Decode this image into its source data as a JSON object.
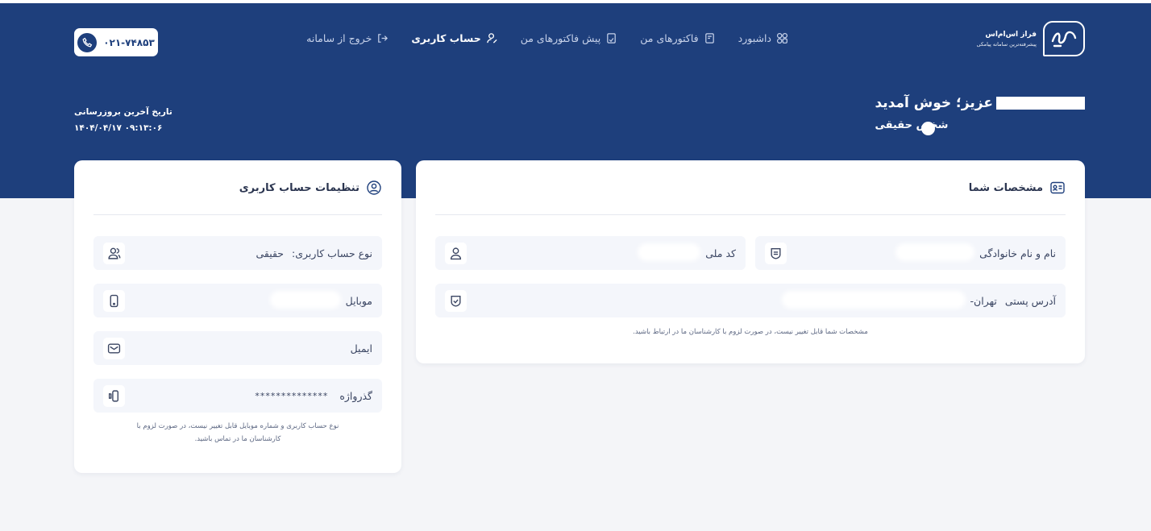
{
  "brand": {
    "name": "فراز اس‌ام‌اس",
    "tagline": "پیشرفته‌ترین سامانه پیامکی"
  },
  "nav": {
    "items": [
      {
        "label": "داشبورد",
        "icon": "dashboard-icon",
        "active": false
      },
      {
        "label": "فاکتورهای من",
        "icon": "invoice-icon",
        "active": false
      },
      {
        "label": "پیش فاکتورهای من",
        "icon": "proforma-icon",
        "active": false
      },
      {
        "label": "حساب کاربری",
        "icon": "user-edit-icon",
        "active": true
      },
      {
        "label": "خروج از سامانه",
        "icon": "logout-icon",
        "active": false
      }
    ]
  },
  "support_phone": "۰۲۱-۷۴۸۵۳",
  "welcome": {
    "greeting": "عزیز؛ خوش آمدید",
    "user_type": "شخص حقیقی"
  },
  "last_update": {
    "label": "تاریخ آخرین بروزرسانی",
    "value": "۱۴۰۴/۰۴/۱۷ ۰۹:۱۳:۰۶"
  },
  "profile_card": {
    "title": "مشخصات شما",
    "fields": {
      "full_name_label": "نام و نام خانوادگی",
      "national_code_label": "کد ملی",
      "address_label": "آدرس پستی",
      "address_value": "تهران-"
    },
    "note": "مشخصات شما قابل تغییر نیست، در صورت لزوم با کارشناسان ما در ارتباط باشید."
  },
  "settings_card": {
    "title": "تنظیمات حساب کاربری",
    "fields": {
      "account_type_label": "نوع حساب کاربری:",
      "account_type_value": "حقیقی",
      "mobile_label": "موبایل",
      "email_label": "ایمیل",
      "password_label": "گذرواژه",
      "password_value": "**************"
    },
    "note_line1": "نوع حساب کاربری و شماره موبایل قابل تغییر نیست، در صورت لزوم با",
    "note_line2": "کارشناسان ما در تماس باشید."
  },
  "colors": {
    "primary": "#1e3f7c",
    "background": "#f4f5f8",
    "field_bg": "#f4f6fb"
  }
}
